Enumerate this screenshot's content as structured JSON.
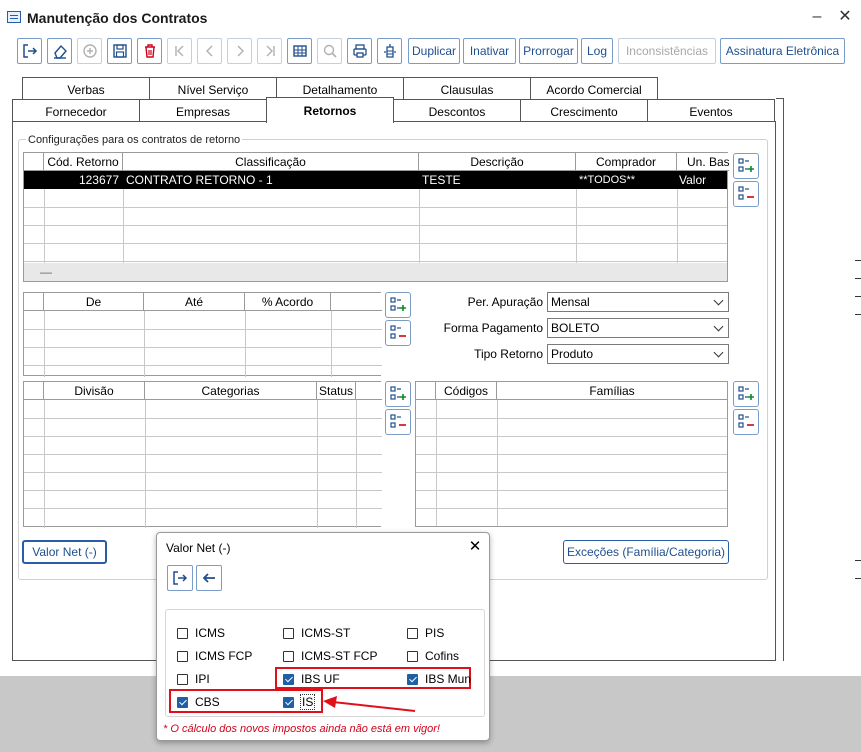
{
  "window": {
    "title": "Manutenção dos Contratos",
    "minimize": "–",
    "close": "✕"
  },
  "toolbar": {
    "icons": [
      "exit-icon",
      "eraser-icon",
      "add-circle-icon",
      "save-icon",
      "trash-icon",
      "first-icon",
      "prev-icon",
      "next-icon",
      "last-icon",
      "grid-icon",
      "search-icon",
      "print-icon",
      "columns-icon"
    ],
    "buttons": [
      "Duplicar",
      "Inativar",
      "Prorrogar",
      "Log",
      "Inconsistências",
      "Assinatura Eletrônica"
    ]
  },
  "tabs_row1": [
    "Verbas",
    "Nível Serviço",
    "Detalhamento",
    "Clausulas",
    "Acordo Comercial"
  ],
  "tabs_row2": [
    "Fornecedor",
    "Empresas",
    "Retornos",
    "Descontos",
    "Crescimento",
    "Eventos"
  ],
  "active_tab": "Retornos",
  "group_title": "Configurações para os contratos de retorno",
  "main_grid": {
    "headers": [
      "Cód. Retorno",
      "Classificação",
      "Descrição",
      "Comprador",
      "Un. Bas"
    ],
    "row": [
      "123677",
      "CONTRATO RETORNO - 1",
      "TESTE",
      "**TODOS**",
      "Valor"
    ],
    "footer": "—"
  },
  "range_grid": {
    "headers": [
      "De",
      "Até",
      "% Acordo"
    ]
  },
  "fields": {
    "per_apuracao": {
      "label": "Per. Apuração",
      "value": "Mensal"
    },
    "forma_pagamento": {
      "label": "Forma Pagamento",
      "value": "BOLETO"
    },
    "tipo_retorno": {
      "label": "Tipo Retorno",
      "value": "Produto"
    }
  },
  "division_grid": {
    "headers": [
      "Divisão",
      "Categorias",
      "Status"
    ]
  },
  "codes_grid": {
    "headers": [
      "Códigos",
      "Famílias"
    ]
  },
  "buttons": {
    "valor_net": "Valor Net (-)",
    "excecoes": "Exceções (Família/Categoria)"
  },
  "dialog": {
    "title": "Valor Net (-)",
    "close": "✕",
    "checkboxes": [
      {
        "label": "ICMS",
        "checked": false
      },
      {
        "label": "ICMS-ST",
        "checked": false
      },
      {
        "label": "PIS",
        "checked": false
      },
      {
        "label": "ICMS FCP",
        "checked": false
      },
      {
        "label": "ICMS-ST FCP",
        "checked": false
      },
      {
        "label": "Cofins",
        "checked": false
      },
      {
        "label": "IPI",
        "checked": false
      },
      {
        "label": "IBS UF",
        "checked": true
      },
      {
        "label": "IBS Mun",
        "checked": true
      },
      {
        "label": "CBS",
        "checked": true
      },
      {
        "label": "IS",
        "checked": true
      }
    ],
    "note": "* O cálculo dos novos impostos ainda não está em vigor!"
  },
  "colors": {
    "accent": "#1e5fa5",
    "highlight": "#e0101a",
    "note": "#d0021b"
  }
}
